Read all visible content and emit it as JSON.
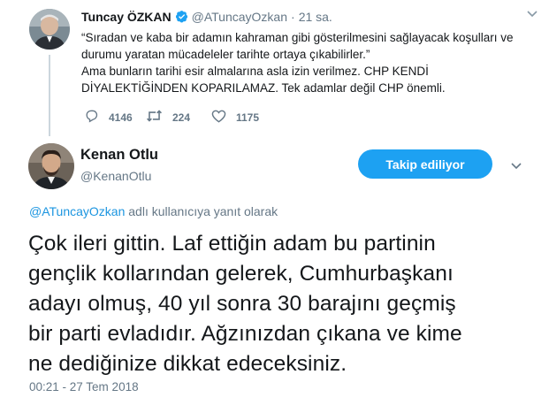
{
  "parent_tweet": {
    "name": "Tuncay ÖZKAN",
    "handle": "@ATuncayOzkan",
    "separator": "·",
    "time": "21 sa.",
    "text": "“Sıradan ve kaba bir adamın kahraman gibi gösterilmesini sağlayacak koşulları ve\ndurumu yaratan mücadeleler tarihte ortaya çıkabilirler.”\nAma bunların tarihi esir almalarına asla izin verilmez. CHP KENDİ\nDİYALEKTİĞİNDEN KOPARILAMAZ. Tek adamlar değil CHP önemli.",
    "replies": "4146",
    "retweets": "224",
    "likes": "1175",
    "icons": {
      "verified": "verified-badge-icon",
      "caret": "chevron-down-icon",
      "reply": "reply-icon",
      "retweet": "retweet-icon",
      "like": "heart-icon"
    }
  },
  "main_tweet": {
    "name": "Kenan Otlu",
    "handle": "@KenanOtlu",
    "follow_label": "Takip ediliyor",
    "reply_mention": "@ATuncayOzkan",
    "reply_suffix": " adlı kullanıcıya yanıt olarak",
    "text": "Çok ileri gittin. Laf ettiğin adam bu partinin\ngençlik kollarından gelerek, Cumhurbaşkanı\nadayı olmuş, 40 yıl sonra 30 barajını geçmiş\nbir parti evladıdır. Ağzınızdan çıkana ve kime\nne dediğinize dikkat edeceksiniz.",
    "timestamp": "00:21 - 27 Tem 2018"
  },
  "colors": {
    "accent": "#1da1f2",
    "link": "#1b95e0",
    "secondary_text": "#657786",
    "primary_text": "#14171a",
    "thread_line": "#ccd6dd"
  }
}
